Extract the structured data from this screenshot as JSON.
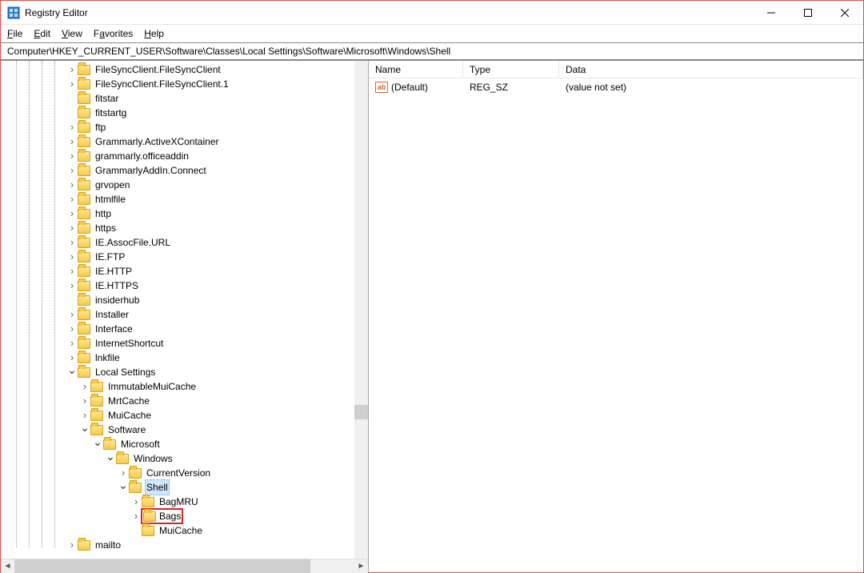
{
  "window": {
    "title": "Registry Editor"
  },
  "menu": {
    "file": "File",
    "edit": "Edit",
    "view": "View",
    "favorites": "Favorites",
    "help": "Help"
  },
  "address": "Computer\\HKEY_CURRENT_USER\\Software\\Classes\\Local Settings\\Software\\Microsoft\\Windows\\Shell",
  "list": {
    "headers": {
      "name": "Name",
      "type": "Type",
      "data": "Data"
    },
    "rows": [
      {
        "name": "(Default)",
        "type": "REG_SZ",
        "data": "(value not set)"
      }
    ]
  },
  "tree": [
    {
      "indent": 5,
      "expander": ">",
      "label": "FileSyncClient.FileSyncClient"
    },
    {
      "indent": 5,
      "expander": ">",
      "label": "FileSyncClient.FileSyncClient.1"
    },
    {
      "indent": 5,
      "expander": "",
      "label": "fitstar"
    },
    {
      "indent": 5,
      "expander": "",
      "label": "fitstartg"
    },
    {
      "indent": 5,
      "expander": ">",
      "label": "ftp"
    },
    {
      "indent": 5,
      "expander": ">",
      "label": "Grammarly.ActiveXContainer"
    },
    {
      "indent": 5,
      "expander": ">",
      "label": "grammarly.officeaddin"
    },
    {
      "indent": 5,
      "expander": ">",
      "label": "GrammarlyAddIn.Connect"
    },
    {
      "indent": 5,
      "expander": ">",
      "label": "grvopen"
    },
    {
      "indent": 5,
      "expander": ">",
      "label": "htmlfile"
    },
    {
      "indent": 5,
      "expander": ">",
      "label": "http"
    },
    {
      "indent": 5,
      "expander": ">",
      "label": "https"
    },
    {
      "indent": 5,
      "expander": ">",
      "label": "IE.AssocFile.URL"
    },
    {
      "indent": 5,
      "expander": ">",
      "label": "IE.FTP"
    },
    {
      "indent": 5,
      "expander": ">",
      "label": "IE.HTTP"
    },
    {
      "indent": 5,
      "expander": ">",
      "label": "IE.HTTPS"
    },
    {
      "indent": 5,
      "expander": "",
      "label": "insiderhub"
    },
    {
      "indent": 5,
      "expander": ">",
      "label": "Installer"
    },
    {
      "indent": 5,
      "expander": ">",
      "label": "Interface"
    },
    {
      "indent": 5,
      "expander": ">",
      "label": "InternetShortcut"
    },
    {
      "indent": 5,
      "expander": ">",
      "label": "lnkfile"
    },
    {
      "indent": 5,
      "expander": "v",
      "label": "Local Settings"
    },
    {
      "indent": 6,
      "expander": ">",
      "label": "ImmutableMuiCache"
    },
    {
      "indent": 6,
      "expander": ">",
      "label": "MrtCache"
    },
    {
      "indent": 6,
      "expander": ">",
      "label": "MuiCache"
    },
    {
      "indent": 6,
      "expander": "v",
      "label": "Software"
    },
    {
      "indent": 7,
      "expander": "v",
      "label": "Microsoft"
    },
    {
      "indent": 8,
      "expander": "v",
      "label": "Windows"
    },
    {
      "indent": 9,
      "expander": ">",
      "label": "CurrentVersion"
    },
    {
      "indent": 9,
      "expander": "v",
      "label": "Shell",
      "selected": true
    },
    {
      "indent": 10,
      "expander": ">",
      "label": "BagMRU"
    },
    {
      "indent": 10,
      "expander": ">",
      "label": "Bags",
      "highlighted": true
    },
    {
      "indent": 10,
      "expander": "",
      "label": "MuiCache"
    },
    {
      "indent": 5,
      "expander": ">",
      "label": "mailto"
    }
  ]
}
